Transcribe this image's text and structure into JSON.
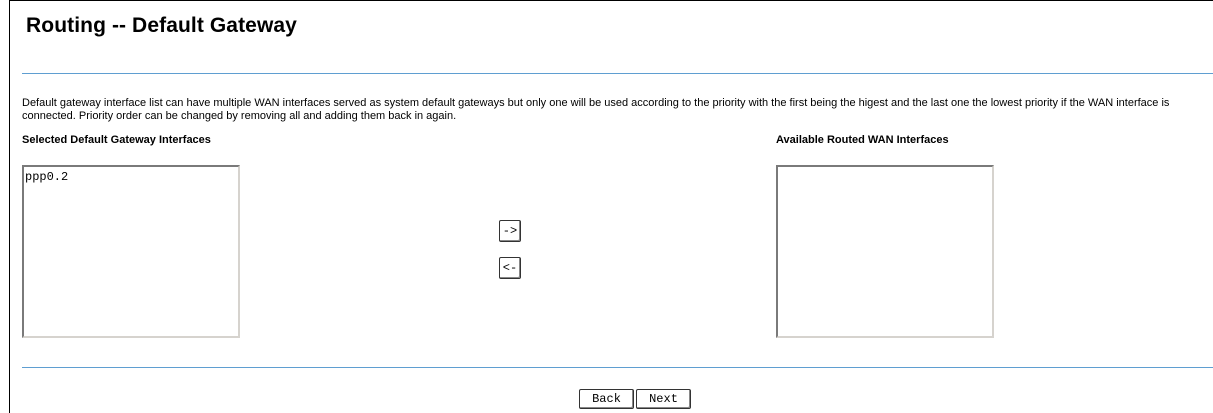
{
  "page": {
    "title": "Routing -- Default Gateway",
    "description": "Default gateway interface list can have multiple WAN interfaces served as system default gateways but only one will be used according to the priority with the first being the higest and the last one the lowest priority if the WAN interface is connected. Priority order can be changed by removing all and adding them back in again."
  },
  "selected": {
    "label": "Selected Default Gateway Interfaces",
    "items": [
      "ppp0.2"
    ]
  },
  "available": {
    "label": "Available Routed WAN Interfaces",
    "items": []
  },
  "move_buttons": {
    "add_label": "->",
    "remove_label": "<-"
  },
  "footer": {
    "back_label": "Back",
    "next_label": "Next"
  }
}
